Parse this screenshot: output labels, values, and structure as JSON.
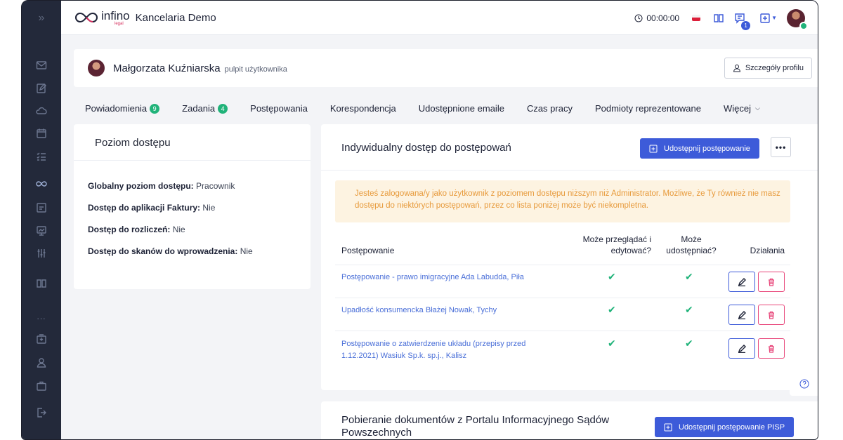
{
  "topbar": {
    "logo_text": "infino",
    "logo_sub": "legal",
    "app_title": "Kancelaria Demo",
    "timer": "00:00:00",
    "messages_badge": "1"
  },
  "sidebar": {
    "collapse_glyph": "»",
    "dots": "..."
  },
  "profile": {
    "name": "Małgorzata Kuźniarska",
    "subtitle": "pulpit użytkownika",
    "details_button": "Szczegóły profilu"
  },
  "tabs": [
    {
      "label": "Powiadomienia",
      "count": "9"
    },
    {
      "label": "Zadania",
      "count": "4"
    },
    {
      "label": "Postępowania"
    },
    {
      "label": "Korespondencja"
    },
    {
      "label": "Udostępnione emaile"
    },
    {
      "label": "Czas pracy"
    },
    {
      "label": "Podmioty reprezentowane"
    },
    {
      "label": "Więcej",
      "chevron": "⌵"
    }
  ],
  "access_card": {
    "title": "Poziom dostępu",
    "rows": [
      {
        "label": "Globalny poziom dostępu:",
        "value": "Pracownik"
      },
      {
        "label": "Dostęp do aplikacji Faktury:",
        "value": "Nie"
      },
      {
        "label": "Dostęp do rozliczeń:",
        "value": "Nie"
      },
      {
        "label": "Dostęp do skanów do wprowadzenia:",
        "value": "Nie"
      }
    ]
  },
  "individual_access": {
    "title": "Indywidualny dostęp do postępowań",
    "share_button": "Udostępnij postępowanie",
    "more_button": "•••",
    "alert": "Jesteś zalogowana/y jako użytkownik z poziomem dostępu niższym niż Administrator. Możliwe, że Ty również nie masz dostępu do niektórych postępowań, przez co lista poniżej może być niekompletna.",
    "columns": {
      "case": "Postępowanie",
      "can_view_edit": "Może przeglądać i edytować?",
      "can_share": "Może udostępniać?",
      "actions": "Działania"
    },
    "rows": [
      {
        "case": "Postępowanie - prawo imigracyjne Ada Labudda, Piła",
        "can_view_edit": "✔",
        "can_share": "✔"
      },
      {
        "case": "Upadłość konsumencka Błażej Nowak, Tychy",
        "can_view_edit": "✔",
        "can_share": "✔"
      },
      {
        "case": "Postępowanie o zatwierdzenie układu (przepisy przed 1.12.2021) Wasiuk Sp.k. sp.j., Kalisz",
        "can_view_edit": "✔",
        "can_share": "✔"
      }
    ]
  },
  "portal_card": {
    "title": "Pobieranie dokumentów z Portalu Informacyjnego Sądów Powszechnych",
    "share_button": "Udostępnij postępowanie PISP"
  },
  "colors": {
    "accent": "#3d5bd9",
    "success": "#21b37a",
    "danger": "#e8467a",
    "warning_text": "#e79a3b",
    "sidebar": "#23293a"
  }
}
